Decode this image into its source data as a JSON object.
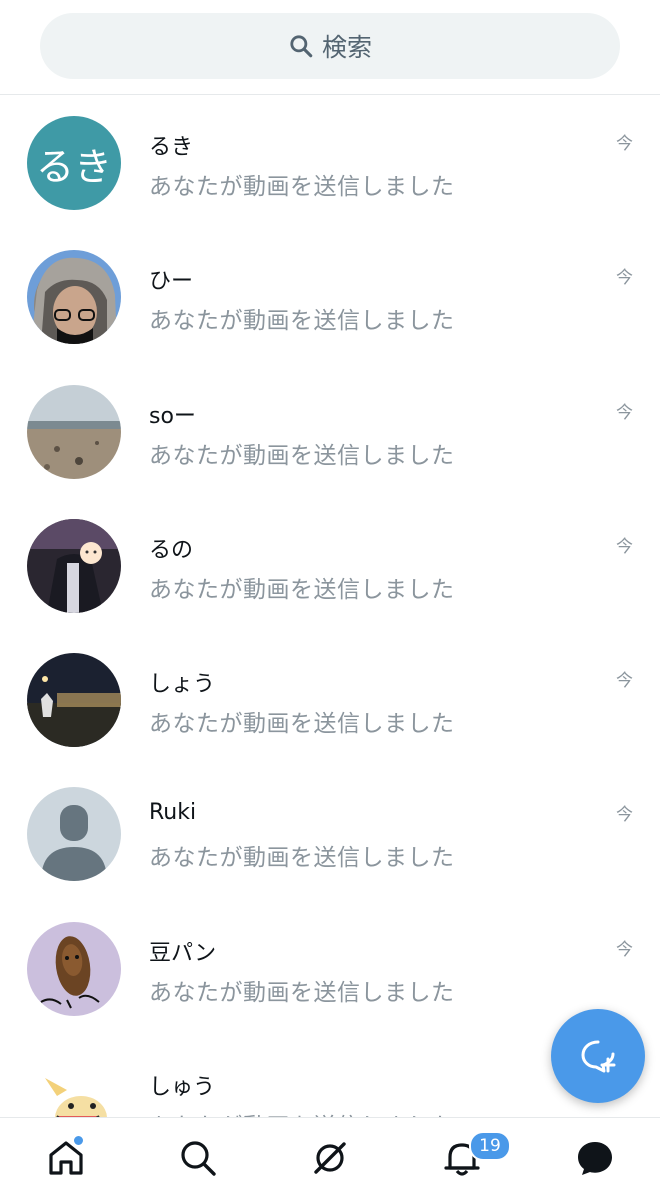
{
  "search": {
    "placeholder": "検索"
  },
  "conversations": [
    {
      "name": "るき",
      "preview": "あなたが動画を送信しました",
      "time": "今",
      "avatar_text": "るき",
      "avatar_color": "#3f9aa6"
    },
    {
      "name": "ひー",
      "preview": "あなたが動画を送信しました",
      "time": "今"
    },
    {
      "name": "soー",
      "preview": "あなたが動画を送信しました",
      "time": "今"
    },
    {
      "name": "るの",
      "preview": "あなたが動画を送信しました",
      "time": "今"
    },
    {
      "name": "しょう",
      "preview": "あなたが動画を送信しました",
      "time": "今"
    },
    {
      "name": "Ruki",
      "preview": "あなたが動画を送信しました",
      "time": "今"
    },
    {
      "name": "豆パン",
      "preview": "あなたが動画を送信しました",
      "time": "今"
    },
    {
      "name": "しゅう",
      "preview": "あなたが動画を送信しました",
      "time": ""
    }
  ],
  "fab": {
    "icon": "new-message-icon"
  },
  "nav": {
    "items": [
      "home-icon",
      "search-icon",
      "spaces-icon",
      "notifications-icon",
      "messages-icon"
    ],
    "notifications_badge": "19"
  },
  "colors": {
    "accent": "#4a99e9",
    "muted_text": "#8b959d"
  }
}
